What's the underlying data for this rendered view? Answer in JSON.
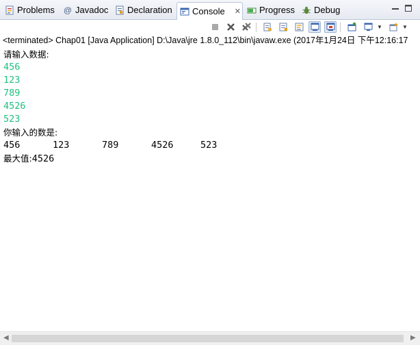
{
  "tabs": [
    {
      "id": "problems",
      "label": "Problems",
      "icon": "problems-icon"
    },
    {
      "id": "javadoc",
      "label": "Javadoc",
      "icon": "javadoc-at-icon",
      "glyph": "@"
    },
    {
      "id": "declaration",
      "label": "Declaration",
      "icon": "declaration-icon"
    },
    {
      "id": "console",
      "label": "Console",
      "icon": "console-icon",
      "close": "✕"
    },
    {
      "id": "progress",
      "label": "Progress",
      "icon": "progress-icon"
    },
    {
      "id": "debug",
      "label": "Debug",
      "icon": "debug-icon"
    }
  ],
  "status_line": "<terminated> Chap01 [Java Application] D:\\Java\\jre 1.8.0_112\\bin\\javaw.exe (2017年1月24日 下午12:16:17",
  "console": {
    "prompt": "请输入数据:",
    "inputs": [
      "456",
      "123",
      "789",
      "4526",
      "523"
    ],
    "echo_label": "你输入的数是:",
    "echo_values": [
      "456",
      "123",
      "789",
      "4526",
      "523"
    ],
    "max_label": "最大值:",
    "max_value": "4526"
  },
  "colors": {
    "input_text": "#1fbf7f",
    "tab_border": "#b9c6d8"
  }
}
